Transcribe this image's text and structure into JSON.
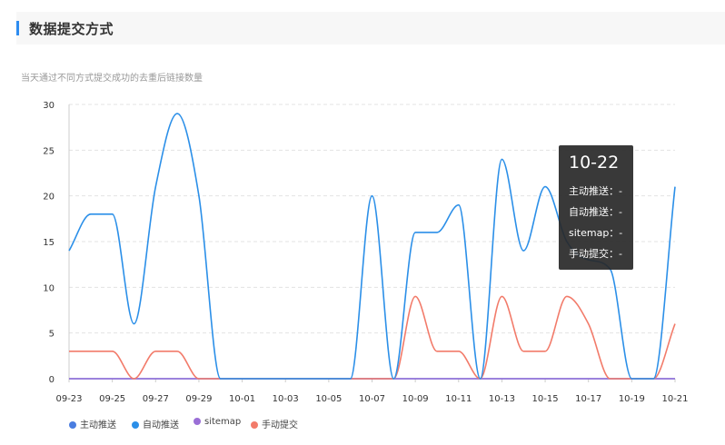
{
  "header": {
    "title": "数据提交方式"
  },
  "subtitle": "当天通过不同方式提交成功的去重后链接数量",
  "tooltip": {
    "title": "10-22",
    "rows": [
      "主动推送：-",
      "自动推送：-",
      "sitemap：-",
      "手动提交：-"
    ]
  },
  "legend": [
    {
      "label": "主动推送",
      "color": "#4a7de0"
    },
    {
      "label": "自动推送",
      "color": "#2b8fe8"
    },
    {
      "label": "sitemap",
      "color": "#9a6fd6"
    },
    {
      "label": "手动提交",
      "color": "#f27b6a"
    }
  ],
  "chart_data": {
    "type": "line",
    "categories": [
      "09-23",
      "09-24",
      "09-25",
      "09-26",
      "09-27",
      "09-28",
      "09-29",
      "09-30",
      "10-01",
      "10-02",
      "10-03",
      "10-04",
      "10-05",
      "10-06",
      "10-07",
      "10-08",
      "10-09",
      "10-10",
      "10-11",
      "10-12",
      "10-13",
      "10-14",
      "10-15",
      "10-16",
      "10-17",
      "10-18",
      "10-19",
      "10-20",
      "10-21"
    ],
    "x_tick_labels": [
      "09-23",
      "09-25",
      "09-27",
      "09-29",
      "10-01",
      "10-03",
      "10-05",
      "10-07",
      "10-09",
      "10-11",
      "10-13",
      "10-15",
      "10-17",
      "10-19",
      "10-21"
    ],
    "ylim": [
      0,
      30
    ],
    "yticks": [
      0,
      5,
      10,
      15,
      20,
      25,
      30
    ],
    "grid": true,
    "legend_position": "bottom-left",
    "series": [
      {
        "name": "主动推送",
        "color": "#4a7de0",
        "values": [
          0,
          0,
          0,
          0,
          0,
          0,
          0,
          0,
          0,
          0,
          0,
          0,
          0,
          0,
          0,
          0,
          0,
          0,
          0,
          0,
          0,
          0,
          0,
          0,
          0,
          0,
          0,
          0,
          0
        ]
      },
      {
        "name": "自动推送",
        "color": "#2b8fe8",
        "values": [
          14,
          18,
          18,
          6,
          21,
          29,
          20,
          0,
          0,
          0,
          0,
          0,
          0,
          0,
          20,
          0,
          16,
          16,
          19,
          0,
          24,
          14,
          21,
          15,
          13,
          12,
          0,
          0,
          21
        ]
      },
      {
        "name": "sitemap",
        "color": "#9a6fd6",
        "values": [
          0,
          0,
          0,
          0,
          0,
          0,
          0,
          0,
          0,
          0,
          0,
          0,
          0,
          0,
          0,
          0,
          0,
          0,
          0,
          0,
          0,
          0,
          0,
          0,
          0,
          0,
          0,
          0,
          0
        ]
      },
      {
        "name": "手动提交",
        "color": "#f27b6a",
        "values": [
          3,
          3,
          3,
          0,
          3,
          3,
          0,
          0,
          0,
          0,
          0,
          0,
          0,
          0,
          0,
          0,
          9,
          3,
          3,
          0,
          9,
          3,
          3,
          9,
          6,
          0,
          0,
          0,
          6
        ]
      }
    ]
  }
}
